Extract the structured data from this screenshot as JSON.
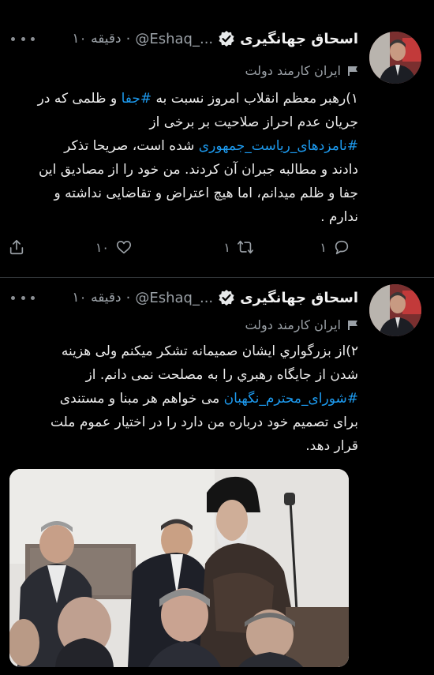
{
  "tweets": [
    {
      "author_name": "اسحاق جهانگیری",
      "author_handle": "@Eshaq_...",
      "separator": "·",
      "time": "۱۰ دقیقه",
      "label": "ایران کارمند دولت",
      "lines": [
        {
          "before": "۱)رهبر معظم انقلاب امروز نسبت به ",
          "tag": "#جفا",
          "after": " و ظلمی که در"
        },
        {
          "before": "جریان عدم احراز صلاحیت بر برخی از",
          "tag": "",
          "after": ""
        },
        {
          "before": "",
          "tag": "#نامزدهای_ریاست_جمهوری",
          "after": " شده است، صریحا تذکر"
        },
        {
          "before": "دادند و مطالبه جبران آن کردند. من خود را از مصادیق این",
          "tag": "",
          "after": ""
        },
        {
          "before": "جفا و ظلم میدانم، اما هیچ اعتراض و تقاضایی نداشته و",
          "tag": "",
          "after": ""
        },
        {
          "before": "ندارم .",
          "tag": "",
          "after": ""
        }
      ],
      "actions": {
        "reply_count": "۱",
        "retweet_count": "۱",
        "like_count": "۱۰"
      }
    },
    {
      "author_name": "اسحاق جهانگیری",
      "author_handle": "@Eshaq_...",
      "separator": "·",
      "time": "۱۰ دقیقه",
      "label": "ایران کارمند دولت",
      "lines": [
        {
          "before": "۲)از بزرگواري ایشان صمیمانه تشکر میکنم ولی هزینه",
          "tag": "",
          "after": ""
        },
        {
          "before": "شدن از جایگاه رهبري را به مصلحت نمی دانم. از",
          "tag": "",
          "after": ""
        },
        {
          "before": "",
          "tag": "#شورای_محترم_نگهبان",
          "after": " می خواهم هر مبنا و مستندی"
        },
        {
          "before": "برای تصمیم خود درباره من دارد را در اختیار عموم ملت",
          "tag": "",
          "after": ""
        },
        {
          "before": "قرار دهد.",
          "tag": "",
          "after": ""
        }
      ]
    }
  ],
  "icons": {
    "more": "more-dots-icon",
    "verified": "verified-badge-icon",
    "label": "flag-label-icon",
    "reply": "reply-icon",
    "retweet": "retweet-icon",
    "like": "heart-icon",
    "share": "share-icon"
  },
  "colors": {
    "background": "#000000",
    "text": "#e7e9ea",
    "secondary": "#9aa0a6",
    "link": "#1d9bf0",
    "divider": "#2f3336"
  }
}
